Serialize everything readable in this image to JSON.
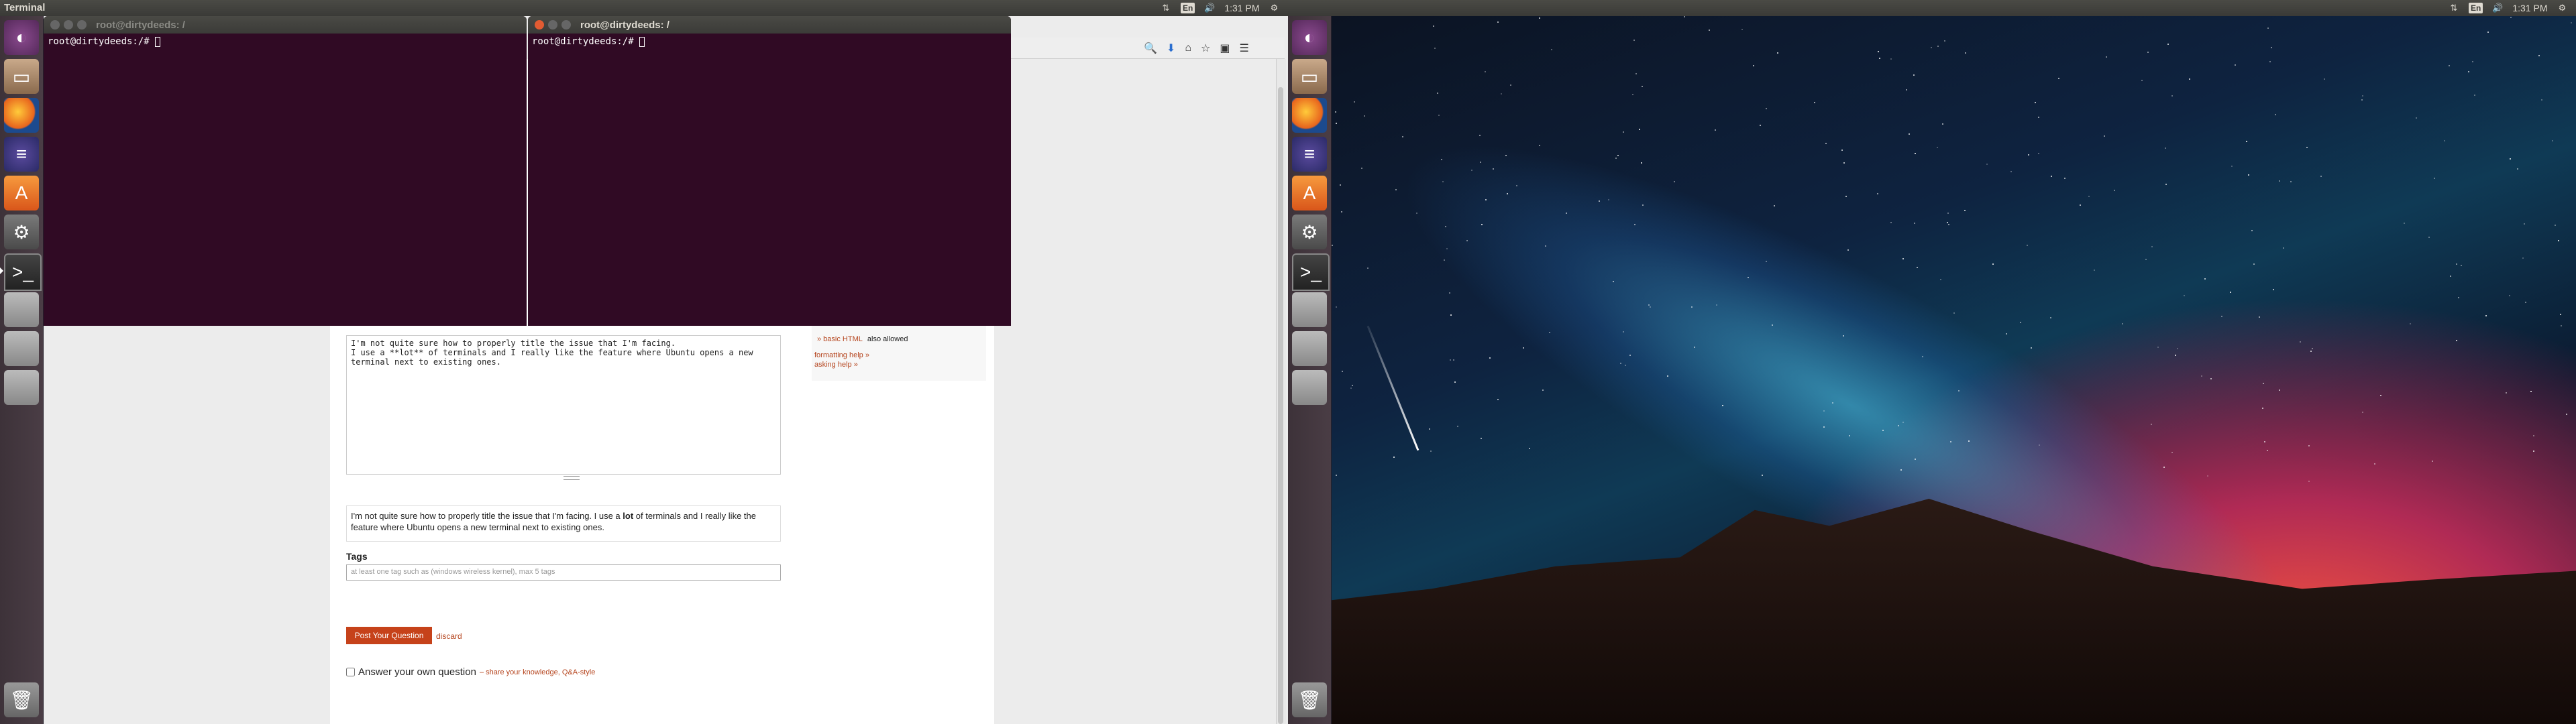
{
  "topbar": {
    "app_title": "Terminal",
    "left_tray": {
      "keyboard": "En",
      "time": "1:31 PM"
    },
    "right_tray": {
      "keyboard": "En",
      "time": "1:31 PM"
    }
  },
  "launcher_icons": [
    "ubuntu-home-icon",
    "files-icon",
    "firefox-icon",
    "eclipse-icon",
    "software-center-icon",
    "system-settings-icon",
    "terminal-icon",
    "drive-icon",
    "drive-icon",
    "drive-icon",
    "trash-icon"
  ],
  "terminals": [
    {
      "title": "root@dirtydeeds: /",
      "prompt": "root@dirtydeeds:/#"
    },
    {
      "title": "root@dirtydeeds: /",
      "prompt": "root@dirtydeeds:/#"
    }
  ],
  "page": {
    "editor_text": "I'm not quite sure how to properly title the issue that I'm facing.\nI use a **lot** of terminals and I really like the feature where Ubuntu opens a new\nterminal next to existing ones.",
    "preview_pre": "I'm not quite sure how to properly title the issue that I'm facing. I use a ",
    "preview_bold": "lot",
    "preview_post": " of terminals and I really like the feature where Ubuntu opens a new terminal next to existing ones.",
    "tags_label": "Tags",
    "tags_placeholder": "at least one tag such as (windows wireless kernel), max 5 tags",
    "post_button": "Post Your Question",
    "discard": "discard",
    "answer_own_label": "Answer your own question",
    "answer_own_hint": "– share your knowledge, Q&A-style",
    "sidebar": {
      "html_note_link": "» basic HTML",
      "html_note_text": "also allowed",
      "formatting_help": "formatting help »",
      "asking_help": "asking help »"
    }
  }
}
